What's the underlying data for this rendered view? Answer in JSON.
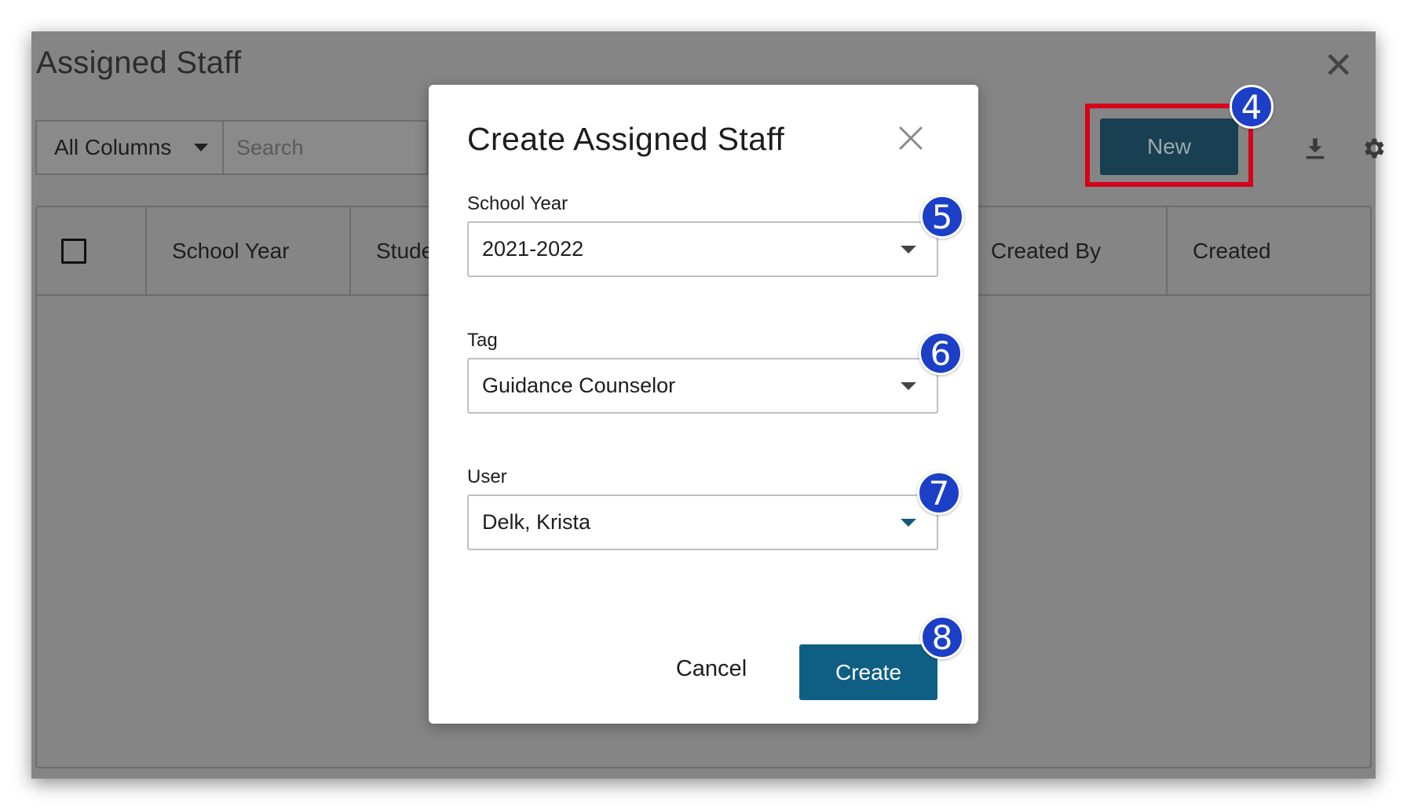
{
  "window": {
    "title": "Assigned Staff",
    "close_glyph": "✕"
  },
  "toolbar": {
    "filter_select": "All Columns",
    "search_placeholder": "Search",
    "new_label": "New",
    "download_icon": "download-icon",
    "settings_icon": "gear-icon"
  },
  "grid": {
    "columns": [
      "School Year",
      "Stude",
      "Created By",
      "Created"
    ]
  },
  "modal": {
    "title": "Create Assigned Staff",
    "close_glyph": "✕",
    "fields": [
      {
        "label": "School Year",
        "value": "2021-2022"
      },
      {
        "label": "Tag",
        "value": "Guidance Counselor"
      },
      {
        "label": "User",
        "value": "Delk, Krista"
      }
    ],
    "cancel_label": "Cancel",
    "create_label": "Create"
  },
  "badges": [
    "4",
    "5",
    "6",
    "7",
    "8"
  ],
  "colors": {
    "overlay_gray": "#858585",
    "new_button": "#183f52",
    "highlight_red": "#d8001a",
    "create_button": "#0f5f85",
    "badge_blue": "#1c3fc7"
  }
}
